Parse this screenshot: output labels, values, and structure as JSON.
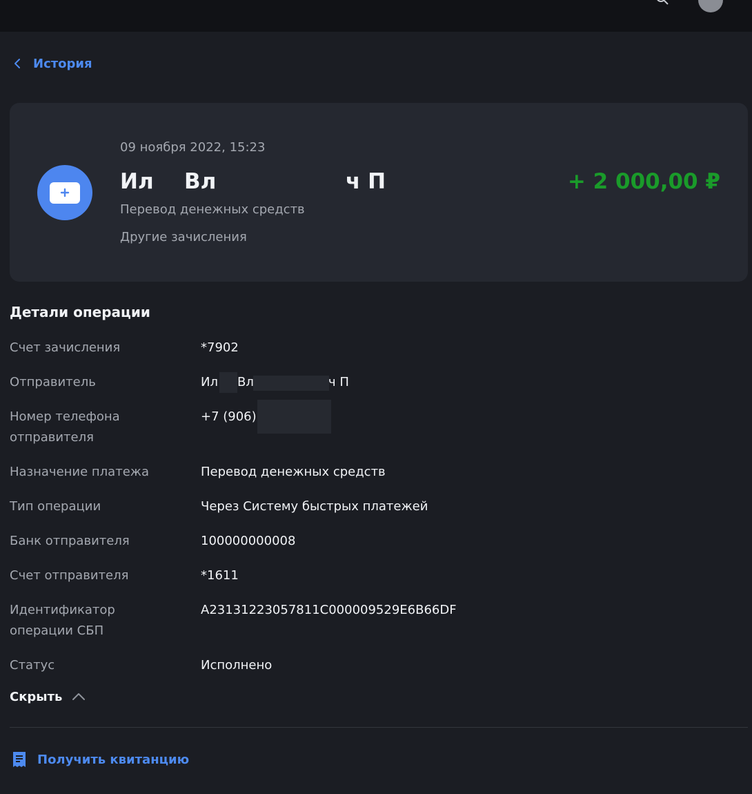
{
  "nav": {
    "back_label": "История"
  },
  "transaction": {
    "date": "09 ноября 2022, 15:23",
    "name_parts": [
      "Ил",
      "Вл",
      "ч П"
    ],
    "subtitle": "Перевод денежных средств",
    "category": "Другие зачисления",
    "amount": "+ 2 000,00 ₽",
    "amount_color": "#1a9b2a",
    "icon": "plus-icon"
  },
  "details": {
    "title": "Детали операции",
    "rows": [
      {
        "label": "Счет зачисления",
        "value": "*7902"
      },
      {
        "label": "Отправитель",
        "value_parts": [
          "Ил",
          "Вл",
          "ч П"
        ]
      },
      {
        "label": "Номер телефона отправителя",
        "value": "+7 (906)"
      },
      {
        "label": "Назначение платежа",
        "value": "Перевод денежных средств"
      },
      {
        "label": "Тип операции",
        "value": "Через Систему быстрых платежей"
      },
      {
        "label": "Банк отправителя",
        "value": "100000000008"
      },
      {
        "label": "Счет отправителя",
        "value": "*1611"
      },
      {
        "label": "Идентификатор операции СБП",
        "value": "A23131223057811C000009529E6B66DF"
      },
      {
        "label": "Статус",
        "value": "Исполнено"
      }
    ],
    "hide_label": "Скрыть"
  },
  "actions": {
    "receipt_label": "Получить квитанцию"
  },
  "colors": {
    "accent": "#4d8af0",
    "background": "#1b1d23",
    "card": "#252830"
  }
}
